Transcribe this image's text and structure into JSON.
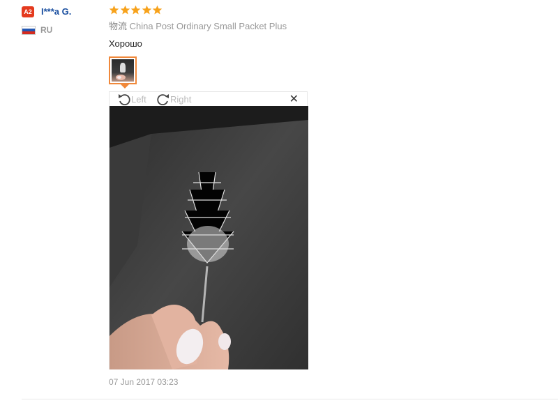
{
  "reviewer": {
    "level_badge": "A2",
    "name": "I***a G.",
    "country_code": "RU"
  },
  "review": {
    "rating": 5,
    "rating_color": "#f7a21b",
    "shipping_label": "物流",
    "shipping_method": "China Post Ordinary Small Packet Plus",
    "text": "Хорошо",
    "date": "07 Jun 2017 03:23"
  },
  "image_viewer": {
    "rotate_left_label": "Left",
    "rotate_right_label": "Right",
    "close_icon": "close-icon",
    "thumbnail_selected": true,
    "accent_color": "#f0883a"
  },
  "colors": {
    "badge": "#e43a1e",
    "name_link": "#1a4fa0",
    "muted_text": "#999999"
  }
}
